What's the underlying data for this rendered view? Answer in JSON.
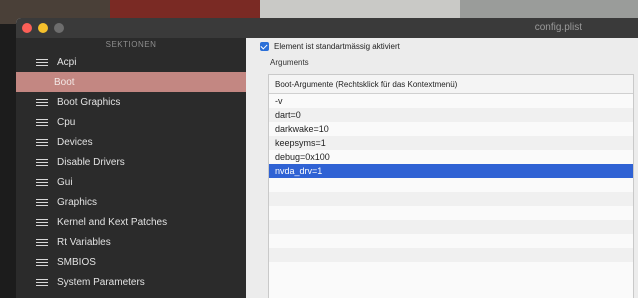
{
  "window": {
    "title": "config.plist"
  },
  "sidebar": {
    "header": "SEKTIONEN",
    "items": [
      {
        "label": "Acpi",
        "selected": false
      },
      {
        "label": "Boot",
        "selected": true
      },
      {
        "label": "Boot Graphics",
        "selected": false
      },
      {
        "label": "Cpu",
        "selected": false
      },
      {
        "label": "Devices",
        "selected": false
      },
      {
        "label": "Disable Drivers",
        "selected": false
      },
      {
        "label": "Gui",
        "selected": false
      },
      {
        "label": "Graphics",
        "selected": false
      },
      {
        "label": "Kernel and Kext Patches",
        "selected": false
      },
      {
        "label": "Rt Variables",
        "selected": false
      },
      {
        "label": "SMBIOS",
        "selected": false
      },
      {
        "label": "System Parameters",
        "selected": false
      }
    ]
  },
  "main": {
    "checkbox": {
      "label": "Element ist standartmässig aktiviert",
      "checked": true
    },
    "section_label": "Arguments",
    "table": {
      "header": "Boot-Argumente (Rechtsklick für das Kontextmenü)",
      "rows": [
        "-v",
        "dart=0",
        "darkwake=10",
        "keepsyms=1",
        "debug=0x100",
        "nvda_drv=1"
      ],
      "selected_row": 5,
      "empty_rows": 7
    }
  },
  "colors": {
    "sidebar_bg": "#2b2b2b",
    "sidebar_selected": "#c38782",
    "row_selected": "#2f62d4",
    "checkbox_blue": "#2a6fd8"
  }
}
